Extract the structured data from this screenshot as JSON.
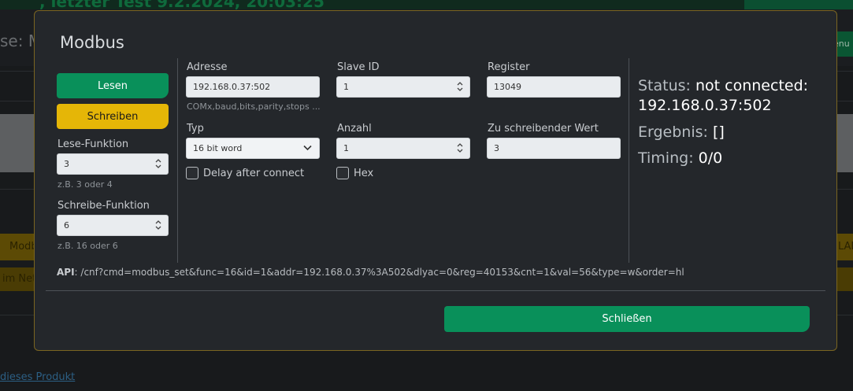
{
  "background": {
    "top_text": ", letzter Test 9.2.2024, 20:03:25",
    "subtitle": "se: M",
    "row_right_text": "enu",
    "yellow_left": "Modb",
    "yellow_right": "LAI",
    "yellow2_left": "im Net",
    "link_text": "dieses Produkt",
    "link_suffix": "."
  },
  "modal": {
    "title": "Modbus",
    "buttons": {
      "read": "Lesen",
      "write": "Schreiben",
      "close": "Schließen"
    },
    "left": {
      "read_function_label": "Lese-Funktion",
      "read_function_value": "3",
      "read_function_hint": "z.B. 3 oder 4",
      "write_function_label": "Schreibe-Funktion",
      "write_function_value": "6",
      "write_function_hint": "z.B. 16 oder 6"
    },
    "fields": {
      "address_label": "Adresse",
      "address_value": "192.168.0.37:502",
      "address_hint": "COMx,baud,bits,parity,stops ...",
      "slave_label": "Slave ID",
      "slave_value": "1",
      "register_label": "Register",
      "register_value": "13049",
      "type_label": "Typ",
      "type_value": "16 bit word",
      "count_label": "Anzahl",
      "count_value": "1",
      "write_value_label": "Zu schreibender Wert",
      "write_value_value": "3",
      "delay_label": "Delay after connect",
      "hex_label": "Hex"
    },
    "status": {
      "status_key": "Status:",
      "status_value_1": "not connected:",
      "status_value_2": "192.168.0.37:502",
      "result_key": "Ergebnis:",
      "result_value": "[]",
      "timing_key": "Timing:",
      "timing_value": "0/0"
    },
    "api": {
      "label": "API",
      "separator": ":",
      "value": " /cnf?cmd=modbus_set&func=16&id=1&addr=192.168.0.37%3A502&dlyac=0&reg=40153&cnt=1&val=56&type=w&order=hl"
    }
  },
  "colors": {
    "primary_green": "#09905a",
    "warning_yellow": "#e5b607",
    "modal_bg": "#24272b",
    "modal_border": "#7a6521"
  }
}
